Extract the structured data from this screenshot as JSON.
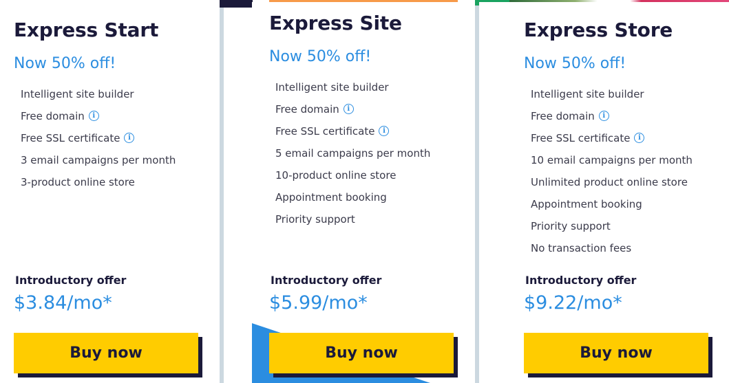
{
  "colors": {
    "title": "#1b1a3a",
    "accent_blue": "#2b8de0",
    "button_yellow": "#ffcc00",
    "button_shadow": "#1b1a3a",
    "divider": "#ccd8e0",
    "highlight_orange": "#f79a4a"
  },
  "plans": [
    {
      "title": "Express Start",
      "promo": "Now 50% off!",
      "features": [
        {
          "text": "Intelligent site builder",
          "info": false
        },
        {
          "text": "Free domain",
          "info": true
        },
        {
          "text": "Free SSL certificate",
          "info": true
        },
        {
          "text": "3 email campaigns per month",
          "info": false
        },
        {
          "text": "3-product online store",
          "info": false
        }
      ],
      "intro_label": "Introductory offer",
      "price": "$3.84/mo*",
      "button_label": "Buy now"
    },
    {
      "title": "Express Site",
      "promo": "Now 50% off!",
      "features": [
        {
          "text": "Intelligent site builder",
          "info": false
        },
        {
          "text": "Free domain",
          "info": true
        },
        {
          "text": "Free SSL certificate",
          "info": true
        },
        {
          "text": "5 email campaigns per month",
          "info": false
        },
        {
          "text": "10-product online store",
          "info": false
        },
        {
          "text": "Appointment booking",
          "info": false
        },
        {
          "text": "Priority support",
          "info": false
        }
      ],
      "intro_label": "Introductory offer",
      "price": "$5.99/mo*",
      "button_label": "Buy now"
    },
    {
      "title": "Express Store",
      "promo": "Now 50% off!",
      "features": [
        {
          "text": "Intelligent site builder",
          "info": false
        },
        {
          "text": "Free domain",
          "info": true
        },
        {
          "text": "Free SSL certificate",
          "info": true
        },
        {
          "text": "10 email campaigns per month",
          "info": false
        },
        {
          "text": "Unlimited product online store",
          "info": false
        },
        {
          "text": "Appointment booking",
          "info": false
        },
        {
          "text": "Priority support",
          "info": false
        },
        {
          "text": "No transaction fees",
          "info": false
        }
      ],
      "intro_label": "Introductory offer",
      "price": "$9.22/mo*",
      "button_label": "Buy now"
    }
  ],
  "icons": {
    "info": "info-circle-icon"
  }
}
